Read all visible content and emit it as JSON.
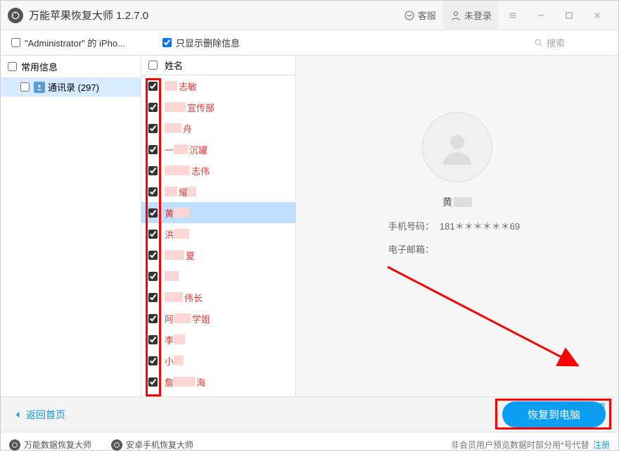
{
  "app": {
    "title": "万能苹果恢复大师  1.2.7.0"
  },
  "topbar": {
    "support": "客服",
    "login": "未登录"
  },
  "control": {
    "device": "\"Administrator\" 的 iPho...",
    "filter": "只显示删除信息",
    "search_placeholder": "搜索"
  },
  "sidebar": {
    "category": "常用信息",
    "contacts_label": "通讯录 (297)"
  },
  "list": {
    "header": "姓名",
    "rows": [
      {
        "clear": "志敏",
        "blur_w": 18
      },
      {
        "clear": "传部",
        "blur_w": 30,
        "pre": "宣"
      },
      {
        "clear": "舟",
        "blur_w": 24
      },
      {
        "clear": "沉罐",
        "blur_w": 20,
        "pre_clear": "一"
      },
      {
        "clear": "志伟",
        "blur_w": 36
      },
      {
        "clear": "耀",
        "blur_w": 18,
        "post_blur": 12
      },
      {
        "clear": "黄",
        "blur_w": 0,
        "post_blur": 22,
        "selected": true,
        "pre_clear": ""
      },
      {
        "clear": "",
        "blur_w": 22,
        "pre_clear": "洪"
      },
      {
        "clear": "",
        "blur_w": 28,
        "post_clear": "夏"
      },
      {
        "clear": "",
        "blur_w": 20
      },
      {
        "clear": "伟长",
        "blur_w": 26
      },
      {
        "clear": "学姐",
        "blur_w": 24,
        "pre_clear": "阿"
      },
      {
        "clear": "李",
        "blur_w": 0,
        "post_blur": 16,
        "pre_clear": ""
      },
      {
        "clear": "小",
        "blur_w": 0,
        "post_blur": 14,
        "pre_clear": ""
      },
      {
        "clear": "",
        "blur_w": 30,
        "post_clear": "海",
        "pre_clear": "詹"
      }
    ]
  },
  "detail": {
    "name": "黄",
    "phone_label": "手机号码：",
    "phone_value": "181＊＊＊＊＊＊69",
    "email_label": "电子邮箱："
  },
  "footer1": {
    "back": "返回首页",
    "privacy": "隐私政策",
    "recover": "恢复到电脑"
  },
  "footer2": {
    "prod1": "万能数据恢复大师",
    "prod2": "安卓手机恢复大师",
    "note": "非会员用户预览数据时部分用*号代替",
    "register": "注册"
  }
}
